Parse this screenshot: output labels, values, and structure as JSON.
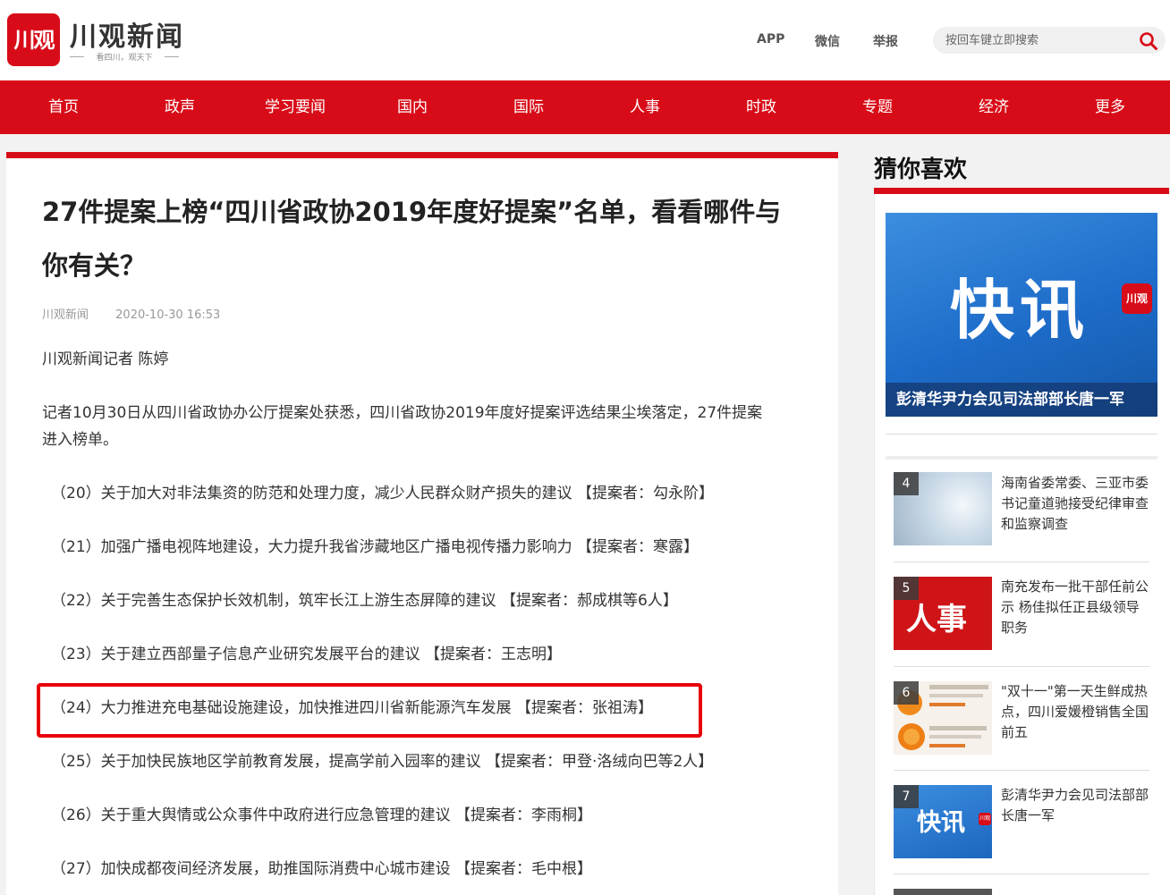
{
  "header": {
    "logo_mark": "川观",
    "logo_name": "川观新闻",
    "slogan": "看四川，观天下",
    "links": [
      "APP",
      "微信",
      "举报"
    ],
    "search_placeholder": "按回车键立即搜索"
  },
  "nav": [
    "首页",
    "政声",
    "学习要闻",
    "国内",
    "国际",
    "人事",
    "时政",
    "专题",
    "经济",
    "更多"
  ],
  "article": {
    "title_line1": "27件提案上榜“四川省政协2019年度好提案”名单，看看哪件与",
    "title_line2": "你有关？",
    "source": "川观新闻",
    "time": "2020-10-30 16:53",
    "byline": "川观新闻记者 陈婷",
    "intro_line1": "记者10月30日从四川省政协办公厅提案处获悉，四川省政协2019年度好提案评选结果尘埃落定，27件提案",
    "intro_line2": "进入榜单。",
    "items": [
      "（20）关于加大对非法集资的防范和处理力度，减少人民群众财产损失的建议 【提案者：勾永阶】",
      "（21）加强广播电视阵地建设，大力提升我省涉藏地区广播电视传播力影响力 【提案者：寒露】",
      "（22）关于完善生态保护长效机制，筑牢长江上游生态屏障的建议 【提案者：郝成棋等6人】",
      "（23）关于建立西部量子信息产业研究发展平台的建议 【提案者：王志明】",
      "（24）大力推进充电基础设施建设，加快推进四川省新能源汽车发展 【提案者：张祖涛】",
      "（25）关于加快民族地区学前教育发展，提高学前入园率的建议 【提案者：甲登·洛绒向巴等2人】",
      "（26）关于重大舆情或公众事件中政府进行应急管理的建议 【提案者：李雨桐】",
      "（27）加快成都夜间经济发展，助推国际消费中心城市建设 【提案者：毛中根】"
    ]
  },
  "sidebar": {
    "title": "猜你喜欢",
    "featured": {
      "big_text": "快讯",
      "badge": "川观",
      "caption": "彭清华尹力会见司法部部长唐一军"
    },
    "recs": [
      {
        "num": "4",
        "text": "海南省委常委、三亚市委书记童道驰接受纪律审查和监察调查"
      },
      {
        "num": "5",
        "thumb_text": "人事",
        "text": "南充发布一批干部任前公示 杨佳拟任正县级领导职务"
      },
      {
        "num": "6",
        "text": "\"双十一\"第一天生鲜成热点，四川爱媛橙销售全国前五"
      },
      {
        "num": "7",
        "thumb_text": "快讯",
        "thumb_badge": "川观",
        "text": "彭清华尹力会见司法部部长唐一军"
      }
    ]
  },
  "colors": {
    "brand_red": "#d80c18",
    "highlight_red": "#e8000b",
    "kuaixun_blue": "#2a7bd6"
  }
}
